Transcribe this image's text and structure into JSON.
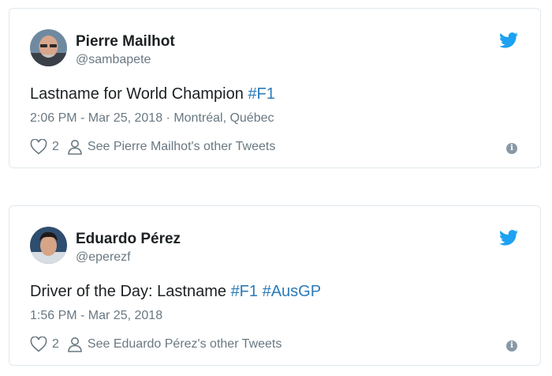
{
  "tweets": [
    {
      "author_name": "Pierre Mailhot",
      "author_handle": "@sambapete",
      "text_parts": [
        "Lastname for World Champion ",
        "#F1"
      ],
      "timestamp": "2:06 PM - Mar 25, 2018",
      "separator": " · ",
      "location": "Montréal, Québec",
      "likes": "2",
      "see_more_label": "See Pierre Mailhot's other Tweets",
      "avatar_icon": "bald-man-avatar"
    },
    {
      "author_name": "Eduardo Pérez",
      "author_handle": "@eperezf",
      "text_parts": [
        "Driver of the Day: Lastname ",
        "#F1",
        " ",
        "#AusGP"
      ],
      "timestamp": "1:56 PM - Mar 25, 2018",
      "likes": "2",
      "see_more_label": "See Eduardo Pérez's other Tweets",
      "avatar_icon": "young-man-avatar"
    }
  ],
  "icons": {
    "brand": "twitter-bird-icon",
    "like": "heart-icon",
    "profile": "person-icon",
    "info": "info-icon"
  },
  "colors": {
    "link": "#2b7bb9",
    "twitter_blue": "#1da1f2",
    "muted": "#697882",
    "border": "#e1e8ed"
  },
  "info_glyph": "i"
}
